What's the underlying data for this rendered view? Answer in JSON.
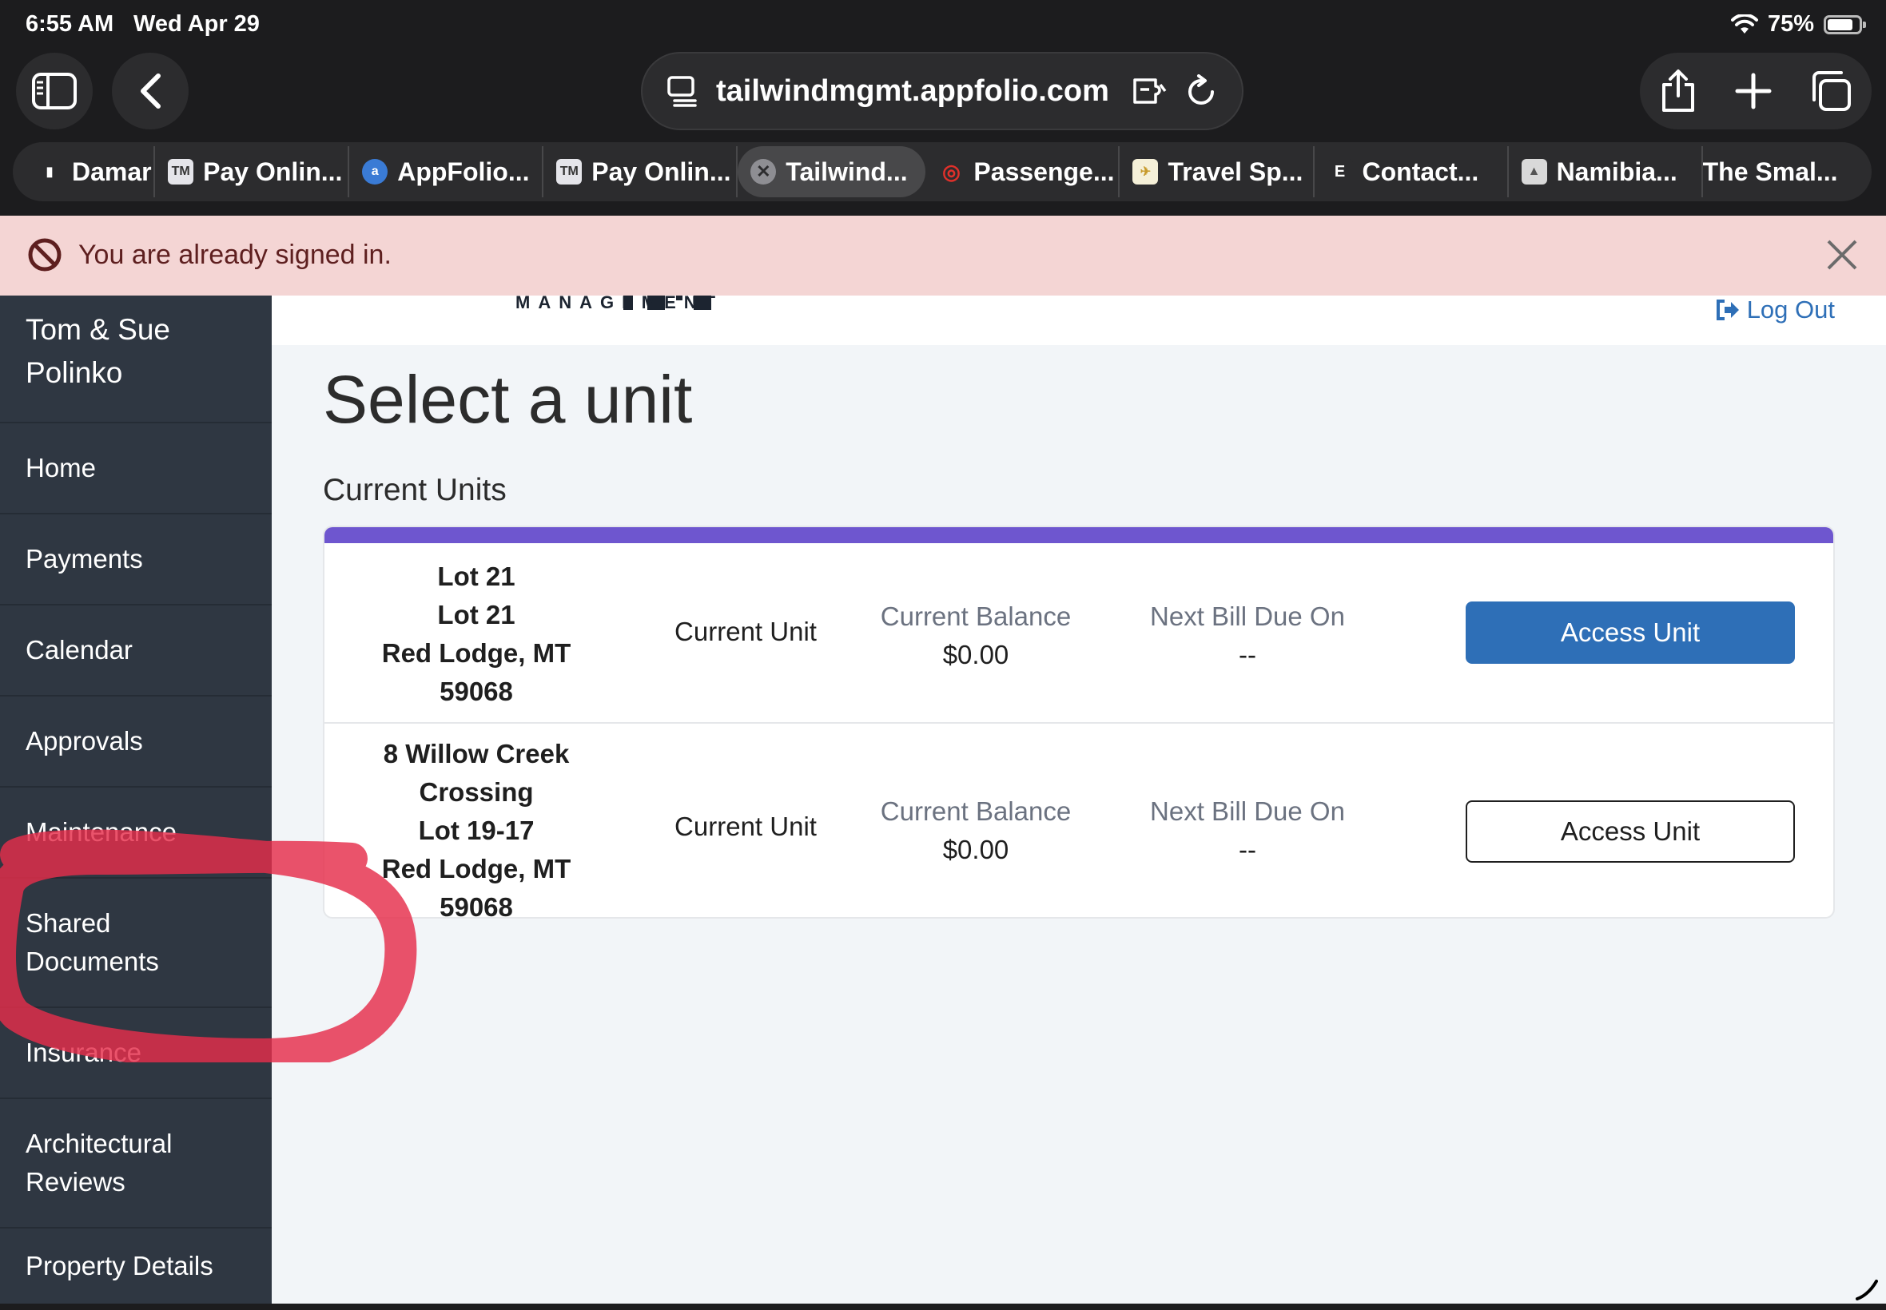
{
  "status_bar": {
    "time": "6:55 AM",
    "date": "Wed Apr 29",
    "battery": "75%"
  },
  "browser": {
    "url": "tailwindmgmt.appfolio.com",
    "tabs": [
      {
        "label": "Damar",
        "icon": "damar-favicon"
      },
      {
        "label": "Pay Onlin...",
        "icon": "tm-favicon"
      },
      {
        "label": "AppFolio...",
        "icon": "appfolio-favicon"
      },
      {
        "label": "Pay Onlin...",
        "icon": "tm-favicon"
      },
      {
        "label": "Tailwind...",
        "icon": "close-tab-icon",
        "active": true
      },
      {
        "label": "Passenge...",
        "icon": "passenger-favicon"
      },
      {
        "label": "Travel Sp...",
        "icon": "travel-favicon"
      },
      {
        "label": "Contact...",
        "icon": "e-favicon"
      },
      {
        "label": "Namibia...",
        "icon": "namibia-favicon"
      },
      {
        "label": "The Smal...",
        "icon": ""
      }
    ]
  },
  "banner": {
    "message": "You are already signed in.",
    "icon": "prohibited-icon"
  },
  "header": {
    "logo_text": "MANAGEMENT",
    "logout_label": "Log Out"
  },
  "sidebar": {
    "owner": "Tom & Sue Polinko",
    "items": [
      {
        "label": "Home"
      },
      {
        "label": "Payments"
      },
      {
        "label": "Calendar"
      },
      {
        "label": "Approvals"
      },
      {
        "label": "Maintenance"
      },
      {
        "label": "Shared Documents"
      },
      {
        "label": "Insurance"
      },
      {
        "label": "Architectural Reviews"
      },
      {
        "label": "Property Details"
      }
    ]
  },
  "main": {
    "title": "Select a unit",
    "section": "Current Units",
    "accent_color": "#6e56cf",
    "units": [
      {
        "address_lines": [
          "Lot 21",
          "Lot 21",
          "Red Lodge, MT",
          "59068"
        ],
        "status": "Current Unit",
        "balance_label": "Current Balance",
        "balance_value": "$0.00",
        "due_label": "Next Bill Due On",
        "due_value": "--",
        "button_label": "Access Unit"
      },
      {
        "address_lines": [
          "8 Willow Creek",
          "Crossing",
          "Lot 19-17",
          "Red Lodge, MT",
          "59068"
        ],
        "status": "Current Unit",
        "balance_label": "Current Balance",
        "balance_value": "$0.00",
        "due_label": "Next Bill Due On",
        "due_value": "--",
        "button_label": "Access Unit"
      }
    ]
  }
}
